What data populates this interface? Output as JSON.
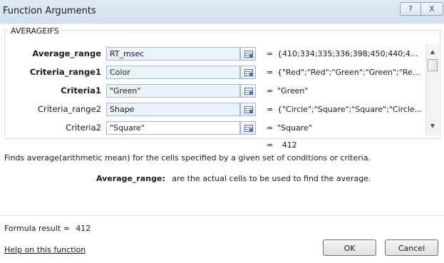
{
  "window": {
    "title": "Function Arguments",
    "help_glyph": "?",
    "close_glyph": "X"
  },
  "function_name": "AVERAGEIFS",
  "arguments": [
    {
      "label": "Average_range",
      "value": "RT_msec",
      "result": "{410;334;335;336;398;450;440;4..."
    },
    {
      "label": "Criteria_range1",
      "value": "Color",
      "result": "{\"Red\";\"Red\";\"Green\";\"Green\";\"Re..."
    },
    {
      "label": "Criteria1",
      "value": "\"Green\"",
      "result": "\"Green\""
    },
    {
      "label": "Criteria_range2",
      "value": "Shape",
      "result": "{\"Circle\";\"Square\";\"Square\";\"Circle..."
    },
    {
      "label": "Criteria2",
      "value": "\"Square\"",
      "result": "\"Square\""
    }
  ],
  "equals_sign": "=",
  "overall_result": "412",
  "description": "Finds average(arithmetic mean) for the cells specified by a given set of conditions or criteria.",
  "arg_help": {
    "name": "Average_range:",
    "text": "are the actual cells to be used to find the average."
  },
  "formula_result": {
    "label": "Formula result =",
    "value": "412"
  },
  "help_link": "Help on this function",
  "buttons": {
    "ok": "OK",
    "cancel": "Cancel"
  },
  "colors": {
    "titlebar": "#d3e1f0",
    "input_fill": "#eaf3fb",
    "input_border": "#a8b8cb"
  }
}
